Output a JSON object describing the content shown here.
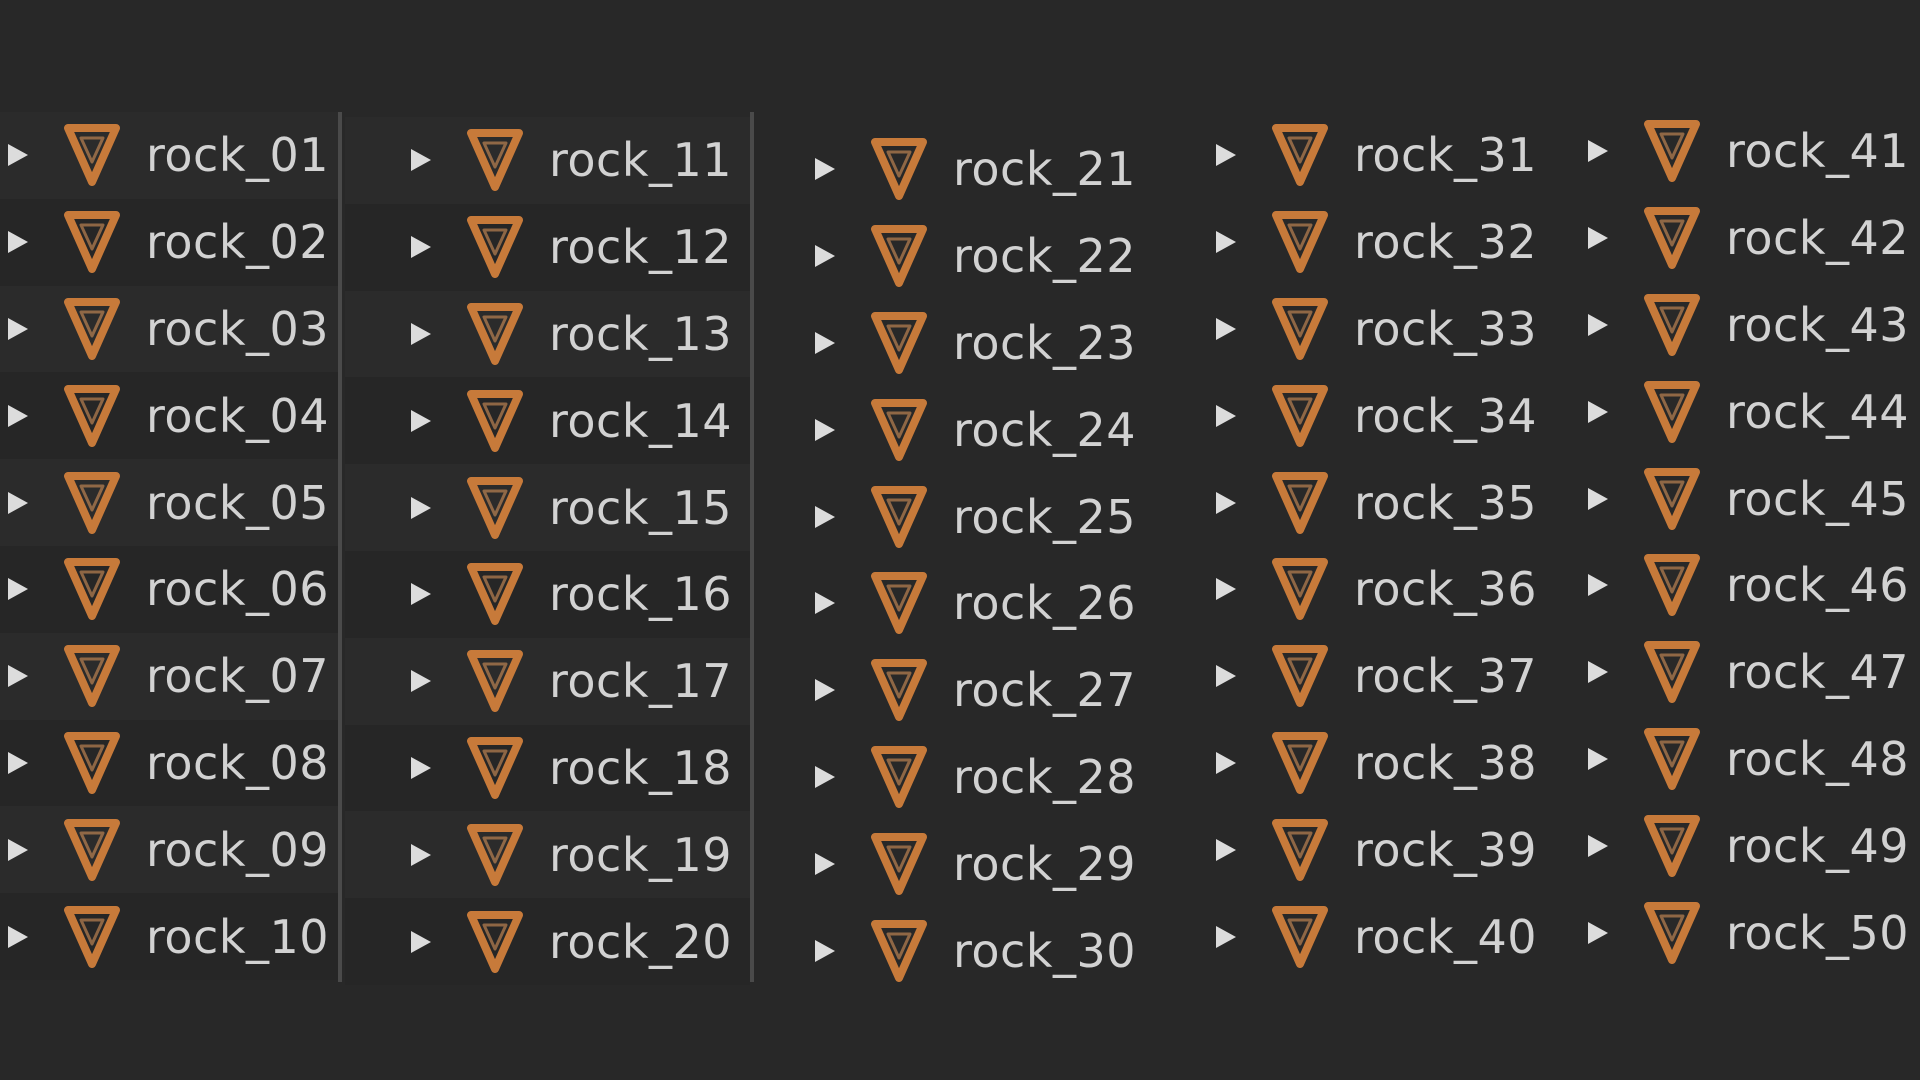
{
  "outliner": {
    "columns": [
      {
        "items": [
          "rock_01",
          "rock_02",
          "rock_03",
          "rock_04",
          "rock_05",
          "rock_06",
          "rock_07",
          "rock_08",
          "rock_09",
          "rock_10"
        ]
      },
      {
        "items": [
          "rock_11",
          "rock_12",
          "rock_13",
          "rock_14",
          "rock_15",
          "rock_16",
          "rock_17",
          "rock_18",
          "rock_19",
          "rock_20"
        ]
      },
      {
        "items": [
          "rock_21",
          "rock_22",
          "rock_23",
          "rock_24",
          "rock_25",
          "rock_26",
          "rock_27",
          "rock_28",
          "rock_29",
          "rock_30"
        ]
      },
      {
        "items": [
          "rock_31",
          "rock_32",
          "rock_33",
          "rock_34",
          "rock_35",
          "rock_36",
          "rock_37",
          "rock_38",
          "rock_39",
          "rock_40"
        ]
      },
      {
        "items": [
          "rock_41",
          "rock_42",
          "rock_43",
          "rock_44",
          "rock_45",
          "rock_46",
          "rock_47",
          "rock_48",
          "rock_49",
          "rock_50"
        ]
      }
    ]
  },
  "icons": {
    "disclosure": "expand-arrow-icon",
    "object": "mesh-object-icon"
  },
  "colors": {
    "background": "#282828",
    "text": "#d2d2d2",
    "icon_accent": "#c77a3a",
    "arrow": "#dcdcdc"
  }
}
